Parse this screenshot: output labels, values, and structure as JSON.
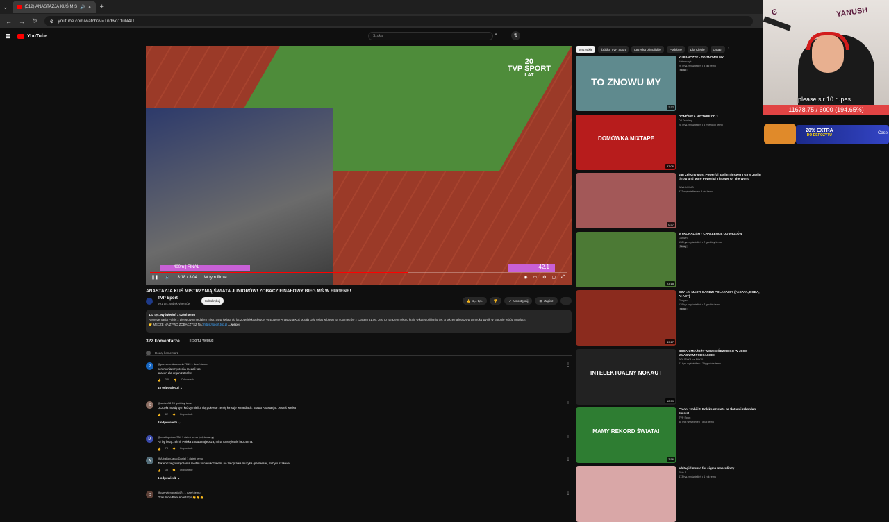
{
  "browser": {
    "tab_title": "(512) ANASTAZJA KUŚ MIS",
    "url": "youtube.com/watch?v=Tndwo11uN4U"
  },
  "header": {
    "logo": "YouTube",
    "search_placeholder": "Szukaj"
  },
  "player": {
    "channel_logo": "TVP SPORT",
    "anniversary": "20",
    "anniversary_sub": "LAT",
    "event_label": "400m | FINAL",
    "timer": "42.1",
    "time": "3:18 / 3:04",
    "chapter": "W tym filmie",
    "progress": 0.62
  },
  "video": {
    "title": "ANASTAZJA KUŚ MISTRZYNIĄ ŚWIATA JUNIORÓW! ZOBACZ FINAŁOWY BIEG MŚ W EUGENE!",
    "channel": "TVP Sport",
    "subs": "991 tys. subskrybentów",
    "subscribe": "Subskrybuj",
    "likes": "2,4 tys.",
    "share": "Udostępnij",
    "save": "Zapisz",
    "desc_meta": "133 tys. wyświetleń  1 dzień temu",
    "desc_text": "Reprezentacja Polski z pierwszym medalem mistrzostw świata do lat 20 w lekkoatletyce! W Eugene Anastazja Kuś ograła cały świat w biegu na 400 metrów z czasem 51.06. Jest to zarazem rekord kraju w kategorii juniorów, a także najlepszy w tym roku wynik w Europie wśród młodych.",
    "desc_link_label": "👉 MECZE NA ŻYWO ZOBACZYSZ NA:",
    "desc_link": "https://sport.tvp.pl",
    "desc_more": "...więcej"
  },
  "comments": {
    "count": "322 komentarze",
    "sort": "Sortuj według",
    "add": "Dodaj komentarz",
    "items": [
      {
        "initial": "P",
        "color": "#1565c0",
        "user": "@prezenteskutecznie7019  1 dzień temu",
        "text": "ceremonia wręczenia medali top\nszacun dla organizatorów",
        "likes": "389",
        "reply": "Odpowiedz",
        "replies": "15 odpowiedzi"
      },
      {
        "initial": "S",
        "color": "#8d6e63",
        "user": "@sedzu98  23 godziny temu",
        "text": "Uczuyła mordy  tym którzy mieli z nią połewkę  że się łonsuje w mediach. Brawo Anastazja . Jesteś wielka",
        "likes": "82",
        "reply": "Odpowiedz",
        "replies": "3 odpowiedzi"
      },
      {
        "initial": "M",
        "color": "#3949ab",
        "user": "@martinpolan4734  1 dzień temu (edytowany)",
        "text": "Aż by lecą....ehhh Polska znowu najlepsza, mina Amerykanki bezcenna.",
        "likes": "78",
        "reply": "Odpowiedz",
        "replies": ""
      },
      {
        "initial": "A",
        "color": "#546e7a",
        "user": "@AlbaBayJavaqDaniel  1 dzień temu",
        "text": "Tak epickiego wręczenia medali to nie widziałem, no za oprawa muzyka gra światel, to było szałowe",
        "likes": "38",
        "reply": "Odpowiedz",
        "replies": "1 odpowiedź"
      },
      {
        "initial": "C",
        "color": "#5d4037",
        "user": "@czerwieniprakh474  1 dzień temu",
        "text": "Gratulacje Pani Anastazjo 👏👏👏",
        "likes": "",
        "reply": "",
        "replies": ""
      }
    ]
  },
  "chips": [
    "Wszystkie",
    "Źródło: TVP Sport",
    "Igrzyska olimpijskie",
    "Podobne",
    "Dla Ciebie",
    "Ostatn"
  ],
  "recommendations": [
    {
      "title": "KUBANCZYK - TO ZNOWU MY",
      "channel": "Kubanczyk",
      "meta": "267 tys. wyświetleń • 3 dni temu",
      "badge": "Nowy",
      "duration": "2:37",
      "thumb_text": "TO ZNOWU MY",
      "thumb_bg": "#5f8a8e"
    },
    {
      "title": "DOMÓWKA MIXTAPE CD.1",
      "channel": "DJ Dobrimy",
      "meta": "287 tys. wyświetleń • 5 miesięcy temu",
      "badge": "",
      "duration": "57:06",
      "thumb_text": "DOMÓWKA MIXTAPE",
      "thumb_bg": "#b71c1c"
    },
    {
      "title": "Jan Zelezny Most Powerful Javlin Thrower I Girls Javlin throw and More Powerful Thrower Of The World",
      "channel": "JAVLIN HUB",
      "meta": "572 wyświetlenia • 9 dni temu",
      "badge": "",
      "duration": "0:37",
      "thumb_text": "",
      "thumb_bg": "#a35858"
    },
    {
      "title": "WYKONALIŚMY CHALLENGE OD WIDZÓW",
      "channel": "Gurgań",
      "meta": "138 tys. wyświetleń • 2 godziny temu",
      "badge": "Nowy",
      "duration": "23:15",
      "thumb_text": "",
      "thumb_bg": "#4c7a35"
    },
    {
      "title": "CZY I.K. MASTI GARDZI POLAKAMI? (FAGATA, DODA, AI ACT)",
      "channel": "Gurgan",
      "meta": "129 tys. wyświetleń • 7 godzin temu",
      "badge": "Nowy",
      "duration": "49:27",
      "thumb_text": "",
      "thumb_bg": "#8b2b1e"
    },
    {
      "title": "BOSAK MIAŻDŻY WOJEWÓDZKIEGO W JEGO WŁASNYM PODCAŚCIE!",
      "channel": "POLITYKA na FAKKU",
      "meta": "21 tys. wyświetleń • 2 tygodnie temu",
      "badge": "",
      "duration": "12:59",
      "thumb_text": "INTELEKTUALNY NOKAUT",
      "thumb_bg": "#222222"
    },
    {
      "title": "Co oni zrobili?! Polska sztafeta ze złotem i rekordem świata!",
      "channel": "TVP Sport",
      "meta": "38 mln wyświetleń • 8 lat temu",
      "badge": "",
      "duration": "3:56",
      "thumb_text": "MAMY REKORD ŚWIATA!",
      "thumb_bg": "#2e7d32"
    },
    {
      "title": "whitegirl music for sigma masculinity",
      "channel": "Sirin 1",
      "meta": "473 tys. wyświetleń • 1 rok temu",
      "badge": "",
      "duration": "",
      "thumb_text": "",
      "thumb_bg": "#d9a7a7"
    }
  ],
  "stream": {
    "wall_left": "Ͼ",
    "wall_mid": "YANUSH",
    "donation": "please sir 10 rupes",
    "goal": "11678.75 / 6000 (194.65%)",
    "promo_title": "20% EXTRA",
    "promo_sub": "DO DEPOZYTU",
    "promo_side": "Case"
  }
}
